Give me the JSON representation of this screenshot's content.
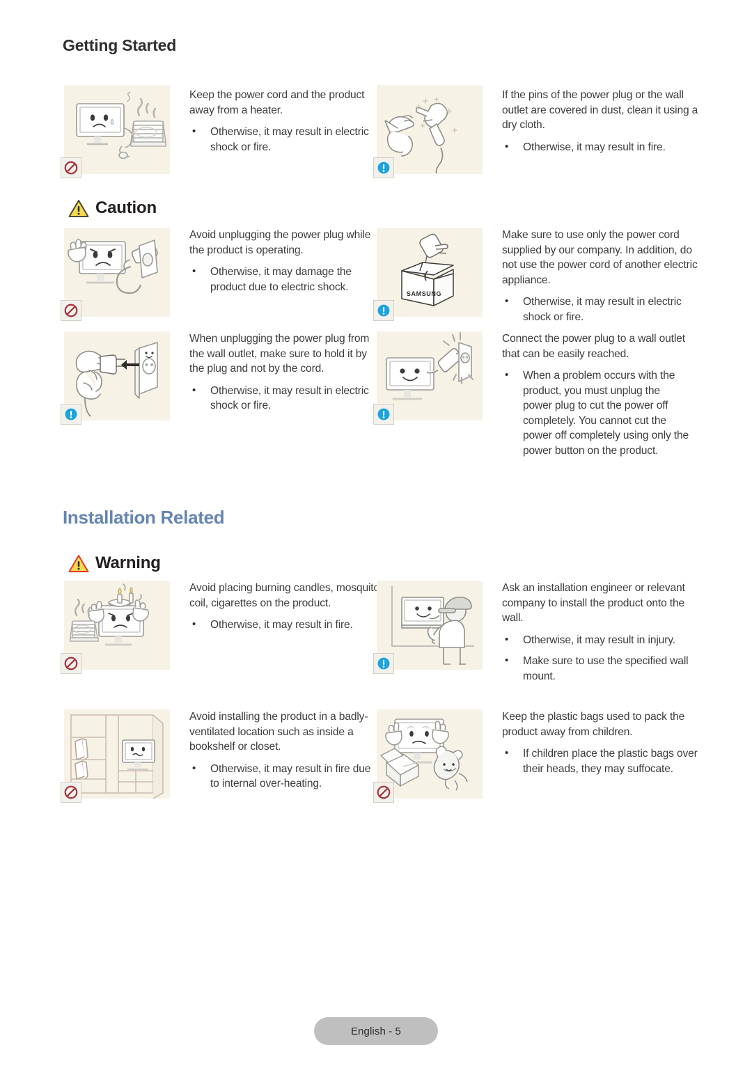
{
  "page": {
    "running_head": "Getting Started",
    "footer_label": "English - 5",
    "accent_heading_color": "#6585b2",
    "illustration_bg": "#f7f2e6",
    "prohibit_color": "#a4353b",
    "info_color": "#1ca3dd",
    "caution_triangle_fill": "#f6d94e",
    "caution_triangle_stroke": "#4a4a35",
    "warning_triangle_fill": "#f6d94e",
    "warning_triangle_stroke": "#e8392b"
  },
  "banners": {
    "caution": {
      "label": "Caution",
      "icon": "warning-triangle-icon"
    },
    "warning": {
      "label": "Warning",
      "icon": "warning-triangle-icon"
    }
  },
  "sections": [
    {
      "id": "getting-started",
      "title": "Getting Started"
    },
    {
      "id": "installation-related",
      "title": "Installation Related"
    }
  ],
  "items": {
    "heater": {
      "name": "keep-cord-away-from-heater",
      "badge": "prohibition-icon",
      "illustration": "monitor-sweating-next-to-heater",
      "lead": "Keep the power cord and the product away from a heater.",
      "bullets": [
        "Otherwise, it may result in electric shock or fire."
      ]
    },
    "dusty_pins": {
      "name": "clean-dusty-plug-pins",
      "badge": "info-icon",
      "illustration": "hand-wiping-plug-with-cloth",
      "lead": "If the pins of the power plug or the wall outlet are covered in dust, clean it using a dry cloth.",
      "bullets": [
        "Otherwise, it may result in fire."
      ]
    },
    "unplug_while_operating": {
      "name": "avoid-unplugging-while-operating",
      "badge": "prohibition-icon",
      "illustration": "angry-monitor-plug-pulled-from-outlet",
      "lead": "Avoid unplugging the power plug while the product is operating.",
      "bullets": [
        "Otherwise, it may damage the product due to electric shock."
      ]
    },
    "supplied_cord": {
      "name": "use-only-supplied-power-cord",
      "badge": "info-icon",
      "illustration": "plug-coming-out-of-samsung-box",
      "illustration_text": "SAMSUNG",
      "lead": "Make sure to use only the power cord supplied by our company. In addition, do not use the power cord of another electric appliance.",
      "bullets": [
        "Otherwise, it may result in electric shock or fire."
      ]
    },
    "hold_by_plug": {
      "name": "hold-plug-not-cord",
      "badge": "info-icon",
      "illustration": "hand-pulling-plug-from-wall-outlet",
      "lead": "When unplugging the power plug from the wall outlet, make sure to hold it by the plug and not by the cord.",
      "bullets": [
        "Otherwise, it may result in electric shock or fire."
      ]
    },
    "reachable_outlet": {
      "name": "connect-to-reachable-outlet",
      "badge": "info-icon",
      "illustration": "smiling-monitor-plug-into-wall-outlet",
      "lead": "Connect the power plug to a wall outlet that can be easily reached.",
      "bullets": [
        "When a problem occurs with the product, you must unplug the power plug to cut the power off completely. You cannot cut the power off completely using only the power button on the product."
      ]
    },
    "burning_candles": {
      "name": "avoid-burning-items-on-product",
      "badge": "prohibition-icon",
      "illustration": "monitor-with-candles-and-heater",
      "lead": "Avoid placing burning candles, mosquito coil, cigarettes on the product.",
      "bullets": [
        "Otherwise, it may result in fire."
      ]
    },
    "installation_engineer": {
      "name": "ask-installation-engineer",
      "badge": "info-icon",
      "illustration": "engineer-installing-monitor-on-wall",
      "lead": "Ask an installation engineer or relevant company to install the product onto the wall.",
      "bullets": [
        "Otherwise, it may result in injury.",
        "Make sure to use the specified wall mount."
      ]
    },
    "ventilation": {
      "name": "avoid-badly-ventilated-location",
      "badge": "prohibition-icon",
      "illustration": "monitor-inside-bookshelf",
      "lead": "Avoid installing the product in a badly-ventilated location such as inside a bookshelf or closet.",
      "bullets": [
        "Otherwise, it may result in fire due to internal over-heating."
      ]
    },
    "plastic_bags": {
      "name": "keep-plastic-bags-from-children",
      "badge": "prohibition-icon",
      "illustration": "monitor-child-and-packing-bags",
      "lead": "Keep the plastic bags used to pack the product away from children.",
      "bullets": [
        "If children place the plastic bags over their heads, they may suffocate."
      ]
    }
  }
}
